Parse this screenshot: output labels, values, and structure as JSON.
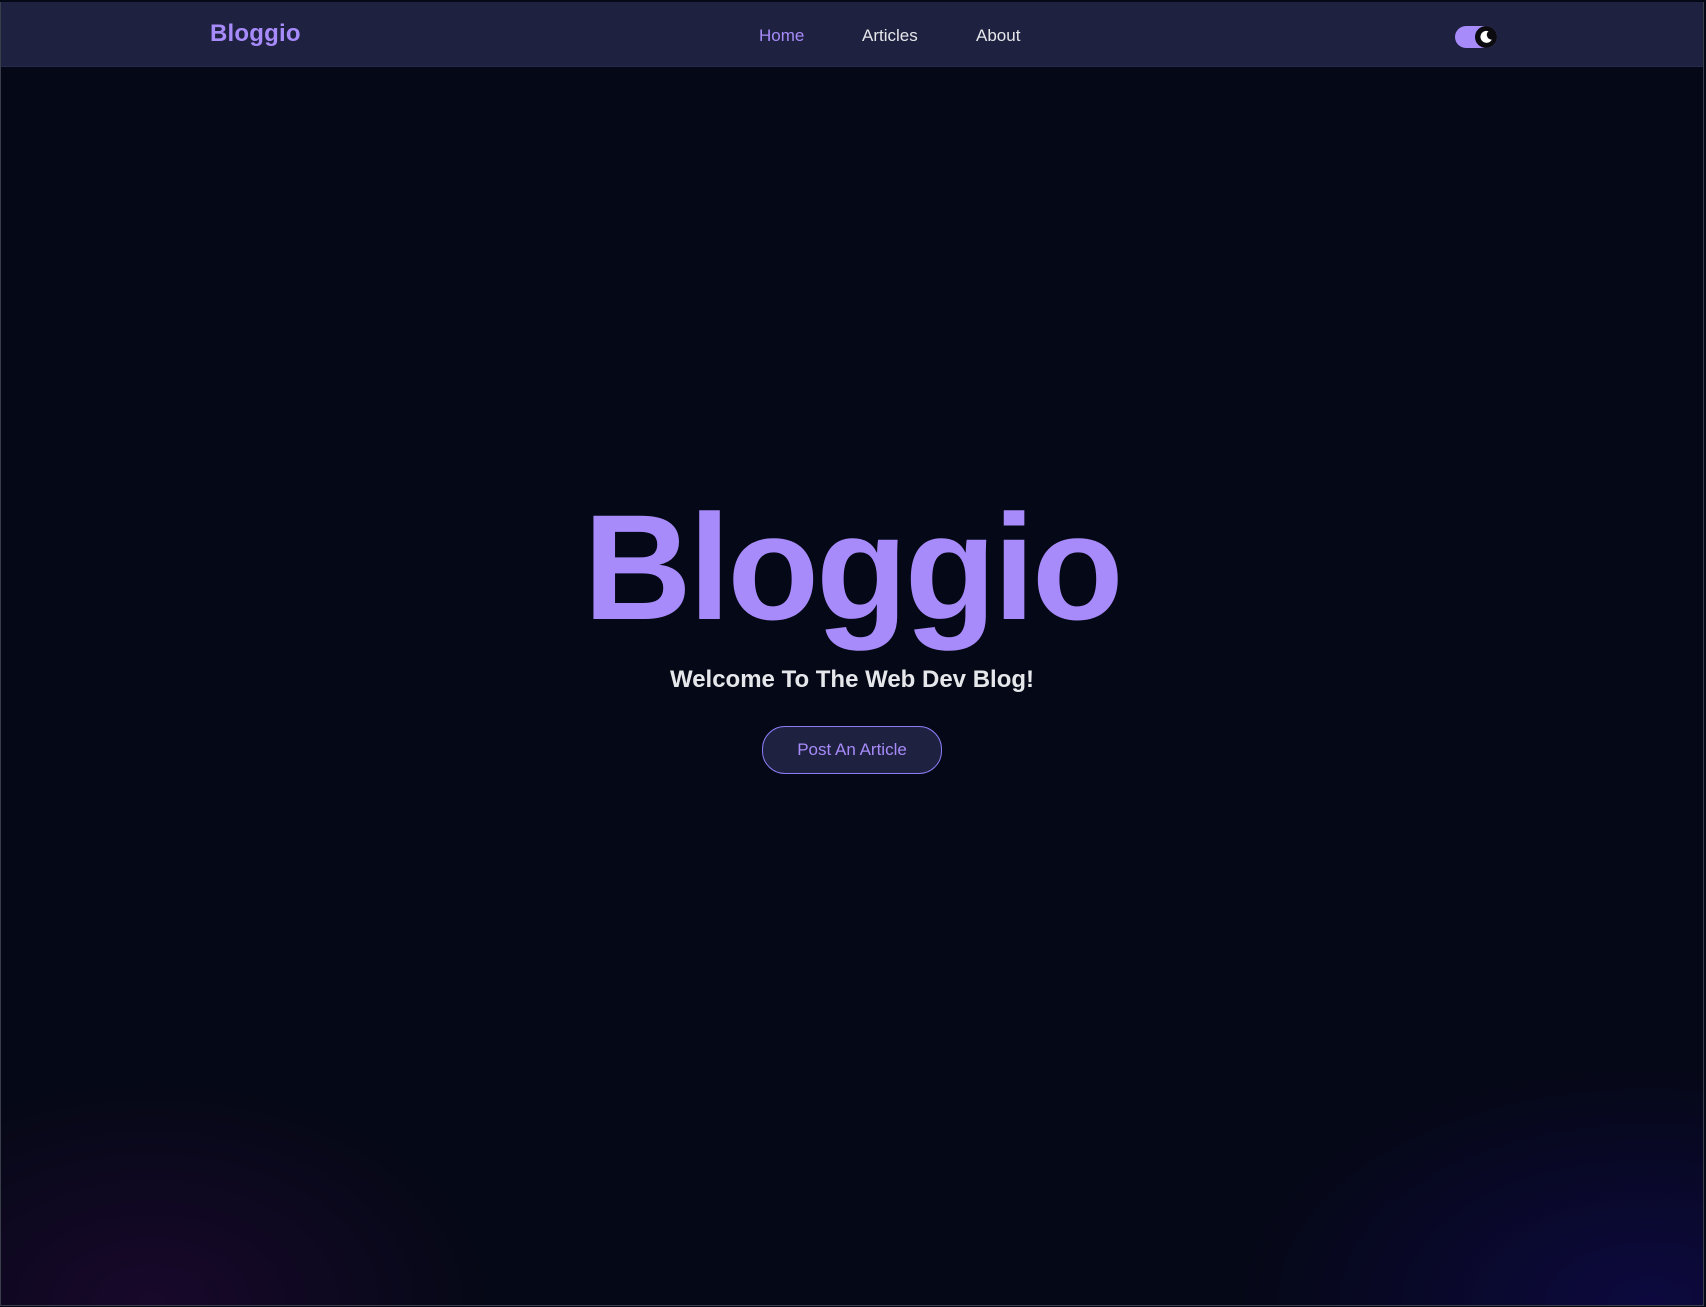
{
  "navbar": {
    "brand": "Bloggio",
    "links": [
      {
        "label": "Home",
        "active": true
      },
      {
        "label": "Articles",
        "active": false
      },
      {
        "label": "About",
        "active": false
      }
    ],
    "theme_toggle_icon": "moon-icon"
  },
  "hero": {
    "title": "Bloggio",
    "subtitle": "Welcome To The Web Dev Blog!",
    "cta_label": "Post An Article"
  },
  "colors": {
    "accent": "#a78bfa",
    "background": "#050816",
    "navbar": "#1f2140",
    "text": "#e5e7eb"
  }
}
